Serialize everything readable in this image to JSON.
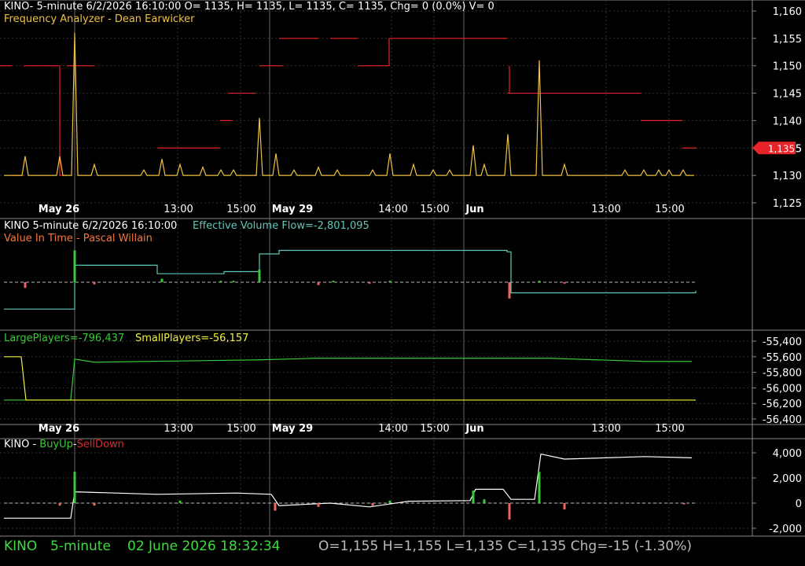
{
  "colors": {
    "background": "#000000",
    "grid": "#444444",
    "axis_text": "#ffffff",
    "red": "#e8232a",
    "gold": "#f0c040",
    "orange": "#f07840",
    "teal": "#5fc8b8",
    "green": "#3ac83a",
    "white": "#ffffff",
    "yellow": "#f0f040",
    "status_green": "#3cdc3c",
    "status_grey": "#bbbbbb"
  },
  "header": {
    "panel1_line1": "KINO- 5-minute 6/2/2026 16:10:00 O= 1135, H= 1135, L= 1135, C= 1135, Chg= 0 (0.0%) V= 0",
    "panel1_line2": "Frequency Analyzer - Dean Earwicker",
    "panel2_line1_a": "KINO 5-minute  6/2/2026 16:10:00",
    "panel2_line1_b": "Effective Volume Flow=-2,801,095",
    "panel2_line2": "Value In Time - Pascal Willain",
    "panel3_large": "LargePlayers=-796,437",
    "panel3_small": "SmallPlayers=-56,157",
    "panel4_ticker": "KINO - ",
    "panel4_buy": "BuyUp",
    "panel4_dash": "-",
    "panel4_sell": "SellDown"
  },
  "price_badge": "1,135",
  "status_bar": {
    "symbol": "KINO",
    "interval": "5-minute",
    "datetime": "02 June 2026 18:32:34",
    "ohlc": "O=1,155  H=1,155  L=1,135  C=1,135  Chg=-15 (-1.30%)"
  },
  "chart_data": [
    {
      "type": "line",
      "panel": "price",
      "title": "Frequency Analyzer - Dean Earwicker",
      "x_labels": [
        "May 26",
        "13:00",
        "15:00",
        "May 29",
        "14:00",
        "15:00",
        "Jun",
        "13:00",
        "15:00"
      ],
      "y_ticks": [
        "1,160",
        "1,155",
        "1,150",
        "1,145",
        "1,140",
        "1,135",
        "1,130",
        "1,125"
      ],
      "ylim": [
        1125,
        1162
      ],
      "grid": true,
      "series": [
        {
          "name": "",
          "color": "red",
          "style": "steps",
          "segments": [
            [
              0,
              1150,
              15
            ],
            [
              15,
              1130,
              30
            ],
            [
              30,
              1150,
              60
            ],
            [
              60,
              1150,
              75
            ],
            [
              75,
              1130,
              85
            ],
            [
              85,
              1150,
              95
            ],
            [
              95,
              1150,
              120
            ],
            [
              200,
              1135,
              280
            ],
            [
              290,
              1145,
              325
            ],
            [
              280,
              1140,
              295
            ],
            [
              330,
              1150,
              360
            ],
            [
              355,
              1155,
              405
            ],
            [
              420,
              1155,
              455
            ],
            [
              455,
              1150,
              495
            ],
            [
              495,
              1155,
              590
            ],
            [
              590,
              1155,
              645
            ],
            [
              645,
              1145,
              815
            ],
            [
              815,
              1140,
              868
            ],
            [
              868,
              1135,
              886
            ]
          ]
        },
        {
          "name": "",
          "color": "gold",
          "style": "spikes",
          "baseline": 1130,
          "spikes": [
            [
              32,
              1133.5
            ],
            [
              76,
              1133.5
            ],
            [
              95,
              1156
            ],
            [
              120,
              1132
            ],
            [
              183,
              1131
            ],
            [
              206,
              1133
            ],
            [
              229,
              1132
            ],
            [
              258,
              1131.5
            ],
            [
              281,
              1131
            ],
            [
              297,
              1131
            ],
            [
              330,
              1140.5
            ],
            [
              351,
              1134
            ],
            [
              374,
              1131
            ],
            [
              405,
              1131.5
            ],
            [
              429,
              1131
            ],
            [
              474,
              1131
            ],
            [
              496,
              1134
            ],
            [
              526,
              1132
            ],
            [
              551,
              1131
            ],
            [
              572,
              1131
            ],
            [
              602,
              1135.5
            ],
            [
              616,
              1132
            ],
            [
              646,
              1137.5
            ],
            [
              686,
              1151
            ],
            [
              718,
              1132
            ],
            [
              795,
              1131
            ],
            [
              819,
              1131
            ],
            [
              838,
              1131
            ],
            [
              851,
              1131
            ],
            [
              869,
              1131
            ]
          ]
        }
      ],
      "last_price": 1135
    },
    {
      "type": "line",
      "panel": "value_in_time",
      "title": "Value In Time - Pascal Willain",
      "series": [
        {
          "name": "Effective Volume Flow",
          "value": -2801095,
          "color": "teal",
          "points": [
            [
              5,
              -3.8
            ],
            [
              90,
              -3.8
            ],
            [
              95,
              2.4
            ],
            [
              200,
              1.2
            ],
            [
              285,
              1.5
            ],
            [
              330,
              4.0
            ],
            [
              355,
              4.5
            ],
            [
              400,
              4.5
            ],
            [
              645,
              4.3
            ],
            [
              650,
              -1.5
            ],
            [
              885,
              -1.2
            ]
          ]
        },
        {
          "name": "",
          "color": "green_red",
          "style": "histogram",
          "bars": [
            [
              32,
              -0.8
            ],
            [
              95,
              4.5
            ],
            [
              120,
              -0.3
            ],
            [
              206,
              0.5
            ],
            [
              281,
              0.2
            ],
            [
              297,
              0.2
            ],
            [
              330,
              1.8
            ],
            [
              405,
              -0.4
            ],
            [
              424,
              0.2
            ],
            [
              470,
              -0.2
            ],
            [
              496,
              0.2
            ],
            [
              648,
              -2.3
            ],
            [
              686,
              0.2
            ],
            [
              718,
              -0.2
            ]
          ]
        }
      ]
    },
    {
      "type": "line",
      "panel": "players",
      "y_ticks": [
        "-55,400",
        "-55,600",
        "-55,800",
        "-56,000",
        "-56,200",
        "-56,400"
      ],
      "ylim": [
        -56450,
        -55400
      ],
      "series": [
        {
          "name": "LargePlayers",
          "value": -796437,
          "color": "green",
          "points": [
            [
              5,
              -56157
            ],
            [
              90,
              -56157
            ],
            [
              95,
              -55630
            ],
            [
              120,
              -55670
            ],
            [
              330,
              -55640
            ],
            [
              400,
              -55620
            ],
            [
              700,
              -55620
            ],
            [
              820,
              -55660
            ],
            [
              880,
              -55660
            ]
          ]
        },
        {
          "name": "SmallPlayers",
          "value": -56157,
          "color": "yellow",
          "points": [
            [
              5,
              -55600
            ],
            [
              27,
              -55600
            ],
            [
              33,
              -56157
            ],
            [
              885,
              -56157
            ]
          ]
        }
      ]
    },
    {
      "type": "line",
      "panel": "buyup_selldown",
      "title": "BuyUp-SellDown",
      "y_ticks": [
        "4,000",
        "2,000",
        "0",
        "-2,000"
      ],
      "ylim": [
        -2400,
        4800
      ],
      "series": [
        {
          "name": "",
          "color": "white",
          "points": [
            [
              5,
              -1200
            ],
            [
              90,
              -1200
            ],
            [
              95,
              900
            ],
            [
              200,
              700
            ],
            [
              300,
              800
            ],
            [
              345,
              700
            ],
            [
              355,
              -200
            ],
            [
              420,
              0
            ],
            [
              470,
              -300
            ],
            [
              520,
              150
            ],
            [
              598,
              200
            ],
            [
              605,
              1100
            ],
            [
              640,
              1100
            ],
            [
              650,
              300
            ],
            [
              680,
              300
            ],
            [
              688,
              3900
            ],
            [
              718,
              3500
            ],
            [
              820,
              3700
            ],
            [
              880,
              3600
            ]
          ]
        },
        {
          "name": "",
          "color": "green_red",
          "style": "histogram",
          "bars": [
            [
              76,
              -200
            ],
            [
              95,
              2500
            ],
            [
              120,
              -200
            ],
            [
              229,
              200
            ],
            [
              350,
              -600
            ],
            [
              405,
              -300
            ],
            [
              474,
              -200
            ],
            [
              496,
              200
            ],
            [
              602,
              1000
            ],
            [
              616,
              300
            ],
            [
              648,
              -1300
            ],
            [
              686,
              2500
            ],
            [
              718,
              -500
            ],
            [
              870,
              -100
            ]
          ]
        }
      ]
    }
  ]
}
